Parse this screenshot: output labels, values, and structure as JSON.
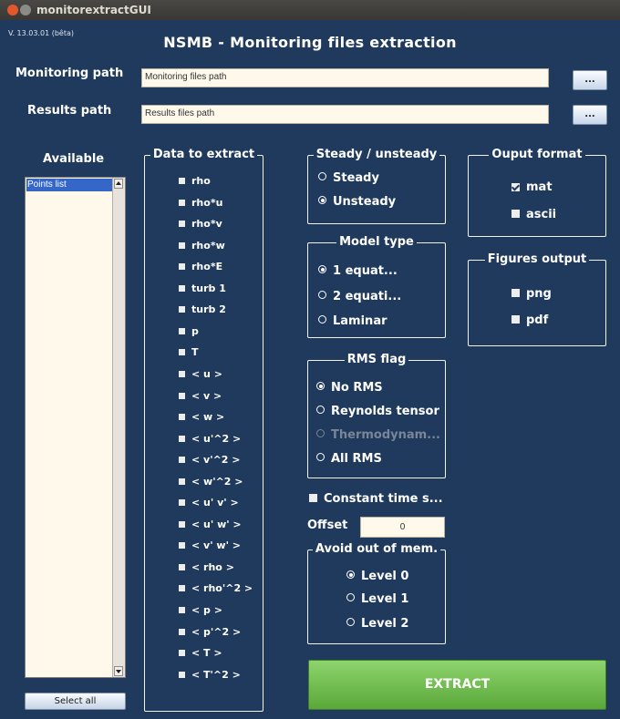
{
  "window": {
    "title": "monitorextractGUI"
  },
  "header": {
    "version": "V. 13.03.01 (bêta)",
    "title": "NSMB - Monitoring files extraction"
  },
  "paths": {
    "monitoring_label": "Monitoring path",
    "monitoring_value": "Monitoring files path",
    "results_label": "Results path",
    "results_value": "Results files path",
    "browse_label": "..."
  },
  "available": {
    "label": "Available",
    "items": [
      "Points list"
    ],
    "select_all": "Select all"
  },
  "data_to_extract": {
    "title": "Data to extract",
    "items": [
      {
        "label": "rho"
      },
      {
        "label": "rho*u"
      },
      {
        "label": "rho*v"
      },
      {
        "label": "rho*w"
      },
      {
        "label": "rho*E"
      },
      {
        "label": "turb 1"
      },
      {
        "label": "turb 2"
      },
      {
        "label": "p"
      },
      {
        "label": "T"
      },
      {
        "label": "< u >"
      },
      {
        "label": "< v >"
      },
      {
        "label": "< w >"
      },
      {
        "label": "< u'^2 >"
      },
      {
        "label": "< v'^2 >"
      },
      {
        "label": "< w'^2 >"
      },
      {
        "label": "< u' v' >"
      },
      {
        "label": "< u' w' >"
      },
      {
        "label": "< v' w' >"
      },
      {
        "label": "< rho >"
      },
      {
        "label": "< rho'^2 >"
      },
      {
        "label": "< p >"
      },
      {
        "label": "< p'^2 >"
      },
      {
        "label": "< T >"
      },
      {
        "label": "< T'^2 >"
      }
    ]
  },
  "steady": {
    "title": "Steady / unsteady",
    "options": [
      "Steady",
      "Unsteady"
    ],
    "selected": "Unsteady"
  },
  "model_type": {
    "title": "Model type",
    "options": [
      "1 equat...",
      "2 equati...",
      "Laminar"
    ],
    "selected": "1 equat..."
  },
  "rms_flag": {
    "title": "RMS flag",
    "options": [
      "No RMS",
      "Reynolds tensor",
      "Thermodynam...",
      "All RMS"
    ],
    "selected": "No RMS",
    "disabled": [
      "Thermodynam..."
    ]
  },
  "constant_time": {
    "label": "Constant time s...",
    "checked": false
  },
  "offset": {
    "label": "Offset",
    "value": "0"
  },
  "memory": {
    "title": "Avoid out of mem.",
    "options": [
      "Level 0",
      "Level 1",
      "Level 2"
    ],
    "selected": "Level 0"
  },
  "output_format": {
    "title": "Ouput format",
    "options": [
      {
        "label": "mat",
        "checked": true
      },
      {
        "label": "ascii",
        "checked": false
      }
    ]
  },
  "figures_output": {
    "title": "Figures output",
    "options": [
      {
        "label": "png",
        "checked": false
      },
      {
        "label": "pdf",
        "checked": false
      }
    ]
  },
  "extract_button": "EXTRACT",
  "colors": {
    "background": "#1f3a5c",
    "extract": "#6cbf49",
    "field": "#fff9ec",
    "selection": "#3467c8"
  }
}
